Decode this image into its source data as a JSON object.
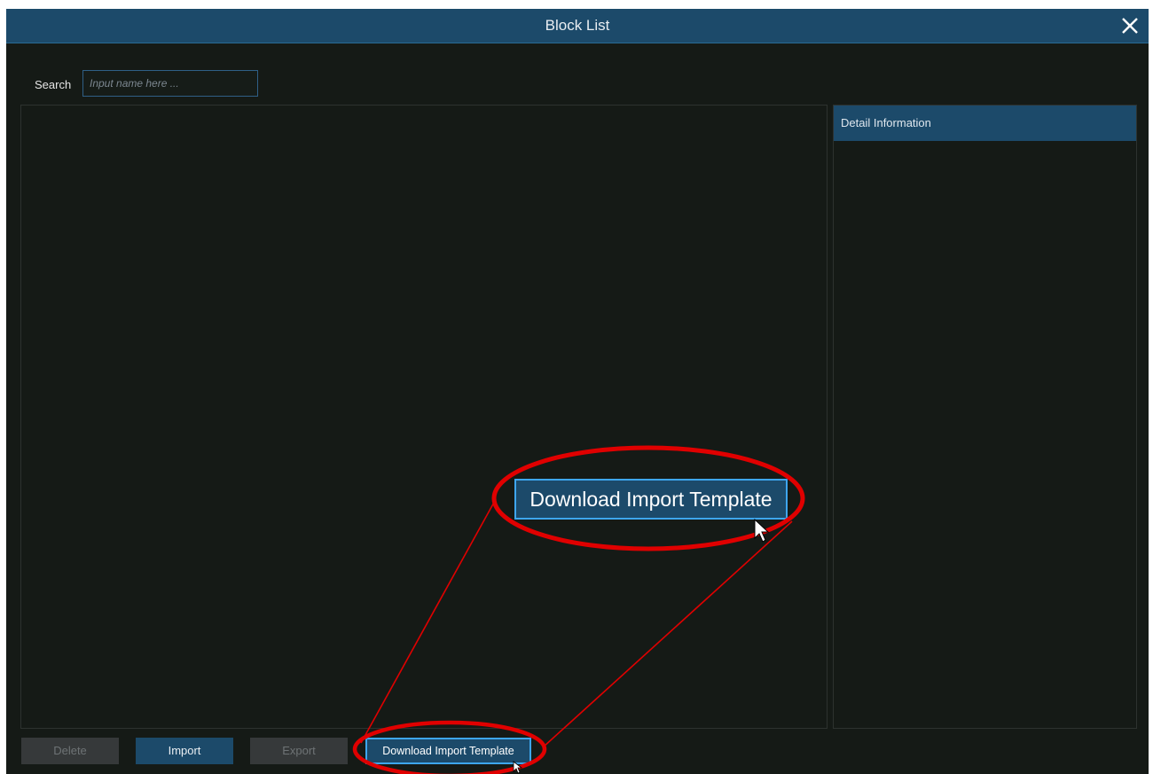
{
  "dialog": {
    "title": "Block List"
  },
  "search": {
    "label": "Search",
    "placeholder": "Input name here ..."
  },
  "detail": {
    "header": "Detail Information"
  },
  "buttons": {
    "delete": "Delete",
    "import": "Import",
    "export": "Export",
    "download_template": "Download Import Template"
  },
  "callout": {
    "zoomed_label": "Download Import Template",
    "highlight_color": "#e00000"
  },
  "colors": {
    "title_bar": "#1c4a6a",
    "background": "#151a16",
    "focus_border": "#3ea6ee"
  }
}
